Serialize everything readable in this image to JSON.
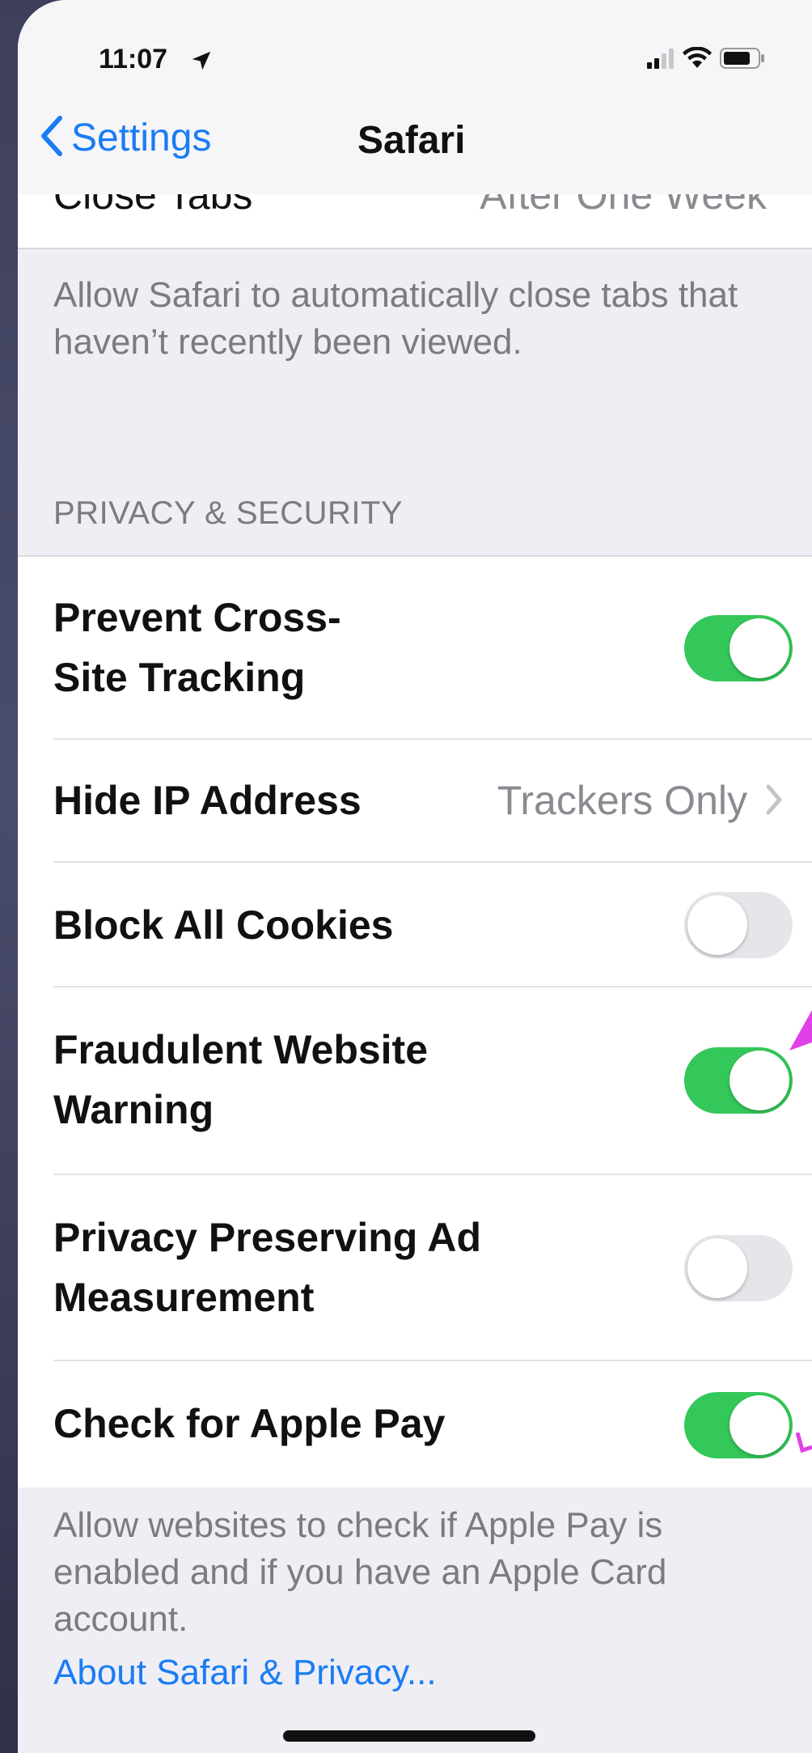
{
  "status_bar": {
    "time": "11:07"
  },
  "nav": {
    "back_label": "Settings",
    "title": "Safari"
  },
  "clipped_row": {
    "label": "Close Tabs",
    "value": "After One Week"
  },
  "close_tabs_footer": "Allow Safari to automatically close tabs that haven’t recently been viewed.",
  "privacy_section": {
    "header": "PRIVACY & SECURITY",
    "rows": [
      {
        "label": "Prevent Cross-Site Tracking",
        "toggle": true
      },
      {
        "label": "Hide IP Address",
        "value": "Trackers Only"
      },
      {
        "label": "Block All Cookies",
        "toggle": false
      },
      {
        "label": "Fraudulent Website Warning",
        "toggle": true
      },
      {
        "label": "Privacy Preserving Ad Measurement",
        "toggle": false
      },
      {
        "label": "Check for Apple Pay",
        "toggle": true
      }
    ],
    "footer": "Allow websites to check if Apple Pay is enabled and if you have an Apple Card account.",
    "link": "About Safari & Privacy..."
  },
  "colors": {
    "accent": "#1a7cf5",
    "toggle_on": "#34c759",
    "toggle_off": "#e5e5ea",
    "annotation": "#e040e8"
  }
}
